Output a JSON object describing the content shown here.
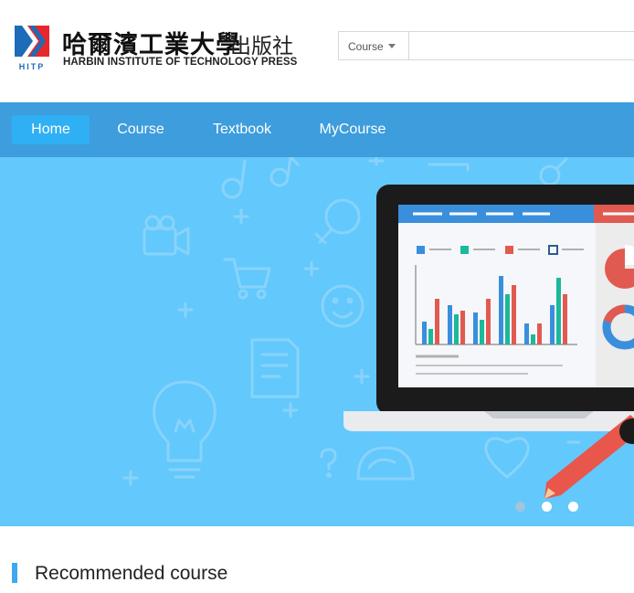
{
  "brand": {
    "chinese_name": "哈爾濱工業大學",
    "chinese_suffix": "出版社",
    "english_name": "HARBIN INSTITUTE OF TECHNOLOGY PRESS",
    "logo_text": "HITP",
    "logo_color": "#e8262d",
    "logo_blue": "#1e6bb8"
  },
  "search": {
    "scope_label": "Course",
    "placeholder": "",
    "value": ""
  },
  "nav": {
    "background": "#3d9ddd",
    "active_color": "#2fb0f4",
    "items": [
      {
        "label": "Home",
        "active": true
      },
      {
        "label": "Course",
        "active": false
      },
      {
        "label": "Textbook",
        "active": false
      },
      {
        "label": "MyCourse",
        "active": false
      }
    ]
  },
  "banner": {
    "background": "#63c8fb",
    "slides_count": 3,
    "active_slide": 1,
    "icons": [
      "music-note-icon",
      "camera-icon",
      "cart-icon",
      "smiley-icon",
      "document-icon",
      "lightbulb-icon",
      "heart-icon",
      "gender-icon",
      "plus-icon",
      "question-icon",
      "laptop-chart-illustration"
    ]
  },
  "recommended": {
    "title": "Recommended course",
    "accent": "#3fa8f0"
  }
}
